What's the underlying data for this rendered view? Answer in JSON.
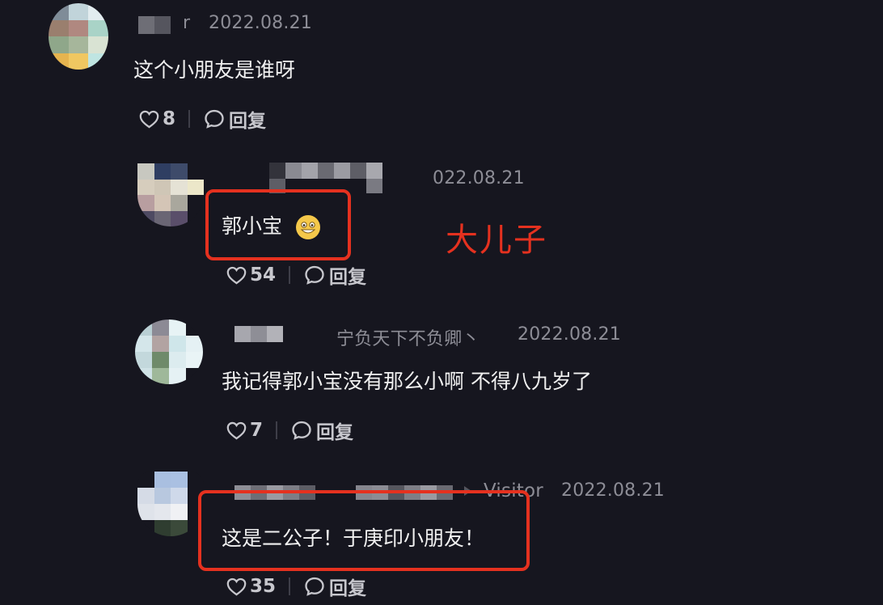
{
  "comments": [
    {
      "name_suffix": "r",
      "date": "2022.08.21",
      "text": "这个小朋友是谁呀",
      "likes": "8",
      "reply_label": "回复"
    },
    {
      "date_partial": "022.08.21",
      "text": "郭小宝",
      "emoji": "grin-emoji",
      "likes": "54",
      "reply_label": "回复"
    },
    {
      "reply_to": "宁负天下不负卿丶",
      "date": "2022.08.21",
      "text": "我记得郭小宝没有那么小啊 不得八九岁了",
      "likes": "7",
      "reply_label": "回复"
    },
    {
      "reply_to": "Visitor",
      "date": "2022.08.21",
      "text": "这是二公子！于庚印小朋友！",
      "likes": "35",
      "reply_label": "回复"
    }
  ],
  "annotation": "大儿子",
  "colors": {
    "background": "#16161f",
    "highlight": "#e5311f",
    "meta": "#8d8d96",
    "text": "#f0f0f0"
  }
}
